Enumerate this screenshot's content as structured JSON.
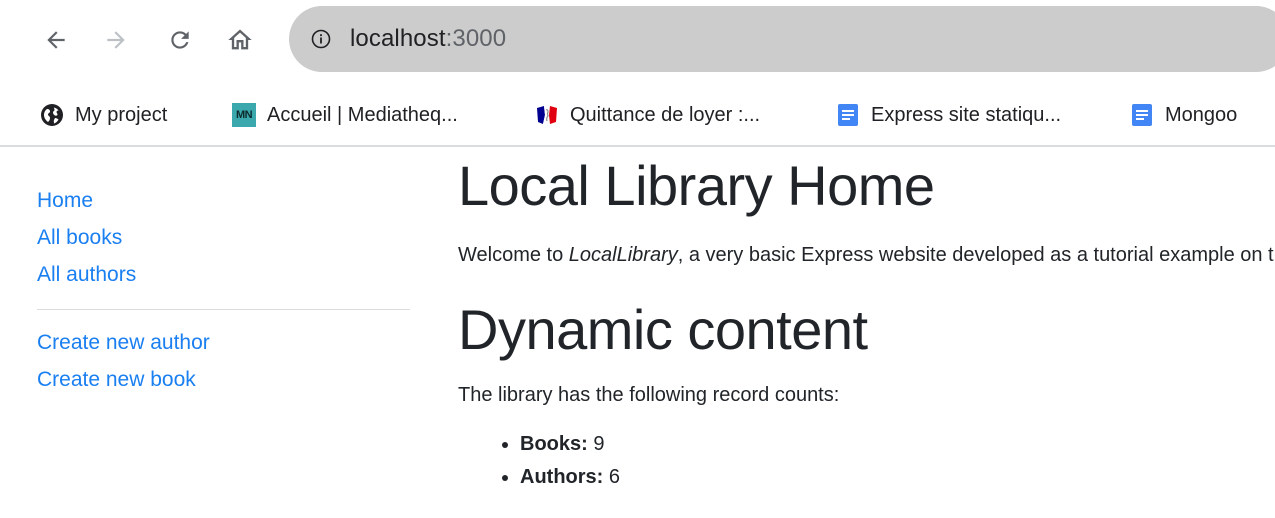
{
  "browser": {
    "url_host": "localhost",
    "url_port": ":3000",
    "bookmarks": [
      {
        "label": "My project",
        "icon": "globe-icon"
      },
      {
        "label": "Accueil | Mediatheq...",
        "icon": "mn-icon",
        "icon_text": "MN"
      },
      {
        "label": "Quittance de loyer :...",
        "icon": "marianne-icon"
      },
      {
        "label": "Express site statiqu...",
        "icon": "google-docs-icon"
      },
      {
        "label": "Mongoo",
        "icon": "google-docs-icon"
      }
    ]
  },
  "sidebar": {
    "links": [
      "Home",
      "All books",
      "All authors"
    ],
    "actions": [
      "Create new author",
      "Create new book"
    ]
  },
  "main": {
    "title": "Local Library Home",
    "welcome_pre": "Welcome to ",
    "welcome_em": "LocalLibrary",
    "welcome_post": ", a very basic Express website developed as a tutorial example on the Mozilla Developer Network.",
    "dynamic_title": "Dynamic content",
    "counts_intro": "The library has the following record counts:",
    "counts": [
      {
        "label": "Books:",
        "value": "9"
      },
      {
        "label": "Authors:",
        "value": "6"
      }
    ]
  },
  "colors": {
    "link": "#1a7ff0",
    "text": "#212529",
    "omnibox": "#cccccc",
    "docs": "#4285f4"
  }
}
